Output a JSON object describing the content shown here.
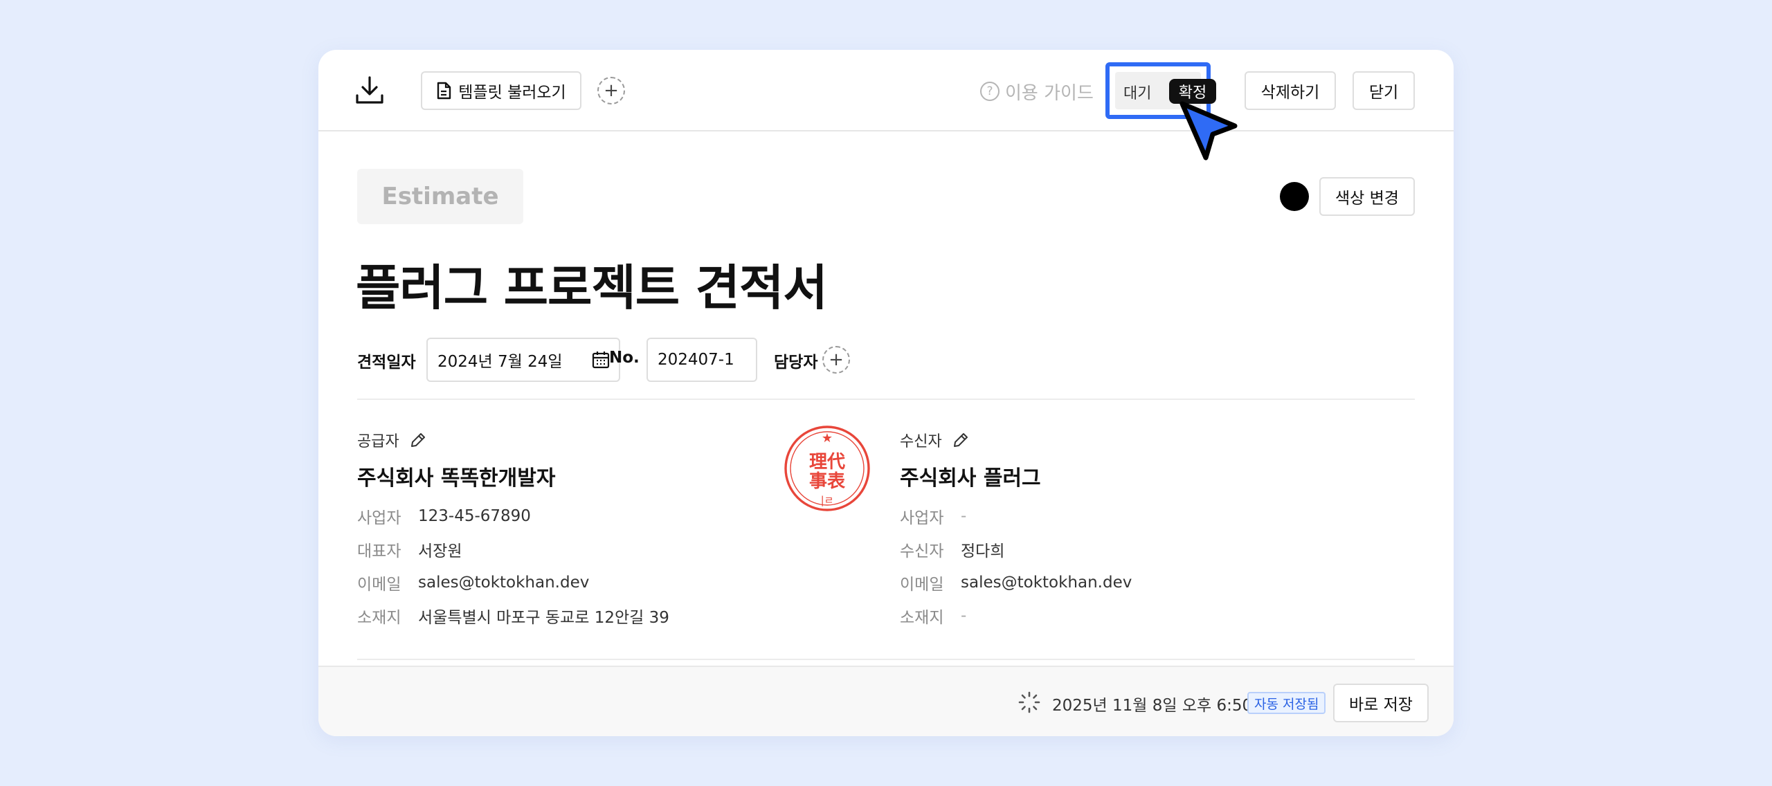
{
  "toolbar": {
    "template_label": "템플릿 불러오기",
    "guide_label": "이용 가이드",
    "status_wait": "대기",
    "status_confirm": "확정",
    "delete_label": "삭제하기",
    "close_label": "닫기"
  },
  "document": {
    "badge": "Estimate",
    "color_change_label": "색상 변경",
    "title": "플러그 프로젝트 견적서",
    "date_label": "견적일자",
    "date_value": "2024년 7월 24일",
    "no_label": "No.",
    "no_value": "202407-1",
    "owner_label": "담당자"
  },
  "supplier": {
    "heading": "공급자",
    "name": "주식회사 똑똑한개발자",
    "rows": [
      {
        "k": "사업자",
        "v": "123-45-67890"
      },
      {
        "k": "대표자",
        "v": "서장원"
      },
      {
        "k": "이메일",
        "v": "sales@toktokhan.dev"
      },
      {
        "k": "소재지",
        "v": "서울특별시 마포구 동교로 12안길 39"
      }
    ]
  },
  "receiver": {
    "heading": "수신자",
    "name": "주식회사 플러그",
    "rows": [
      {
        "k": "사업자",
        "v": "-"
      },
      {
        "k": "수신자",
        "v": "정다희"
      },
      {
        "k": "이메일",
        "v": "sales@toktokhan.dev"
      },
      {
        "k": "소재지",
        "v": "-"
      }
    ]
  },
  "footer": {
    "saved_time": "2025년 11월 8일 오후 6:50",
    "auto_saved": "자동 저장됨",
    "save_now_label": "바로 저장"
  },
  "colors": {
    "background": "#e5edfd",
    "accent": "#2f6bf5",
    "seal": "#e8463a"
  }
}
